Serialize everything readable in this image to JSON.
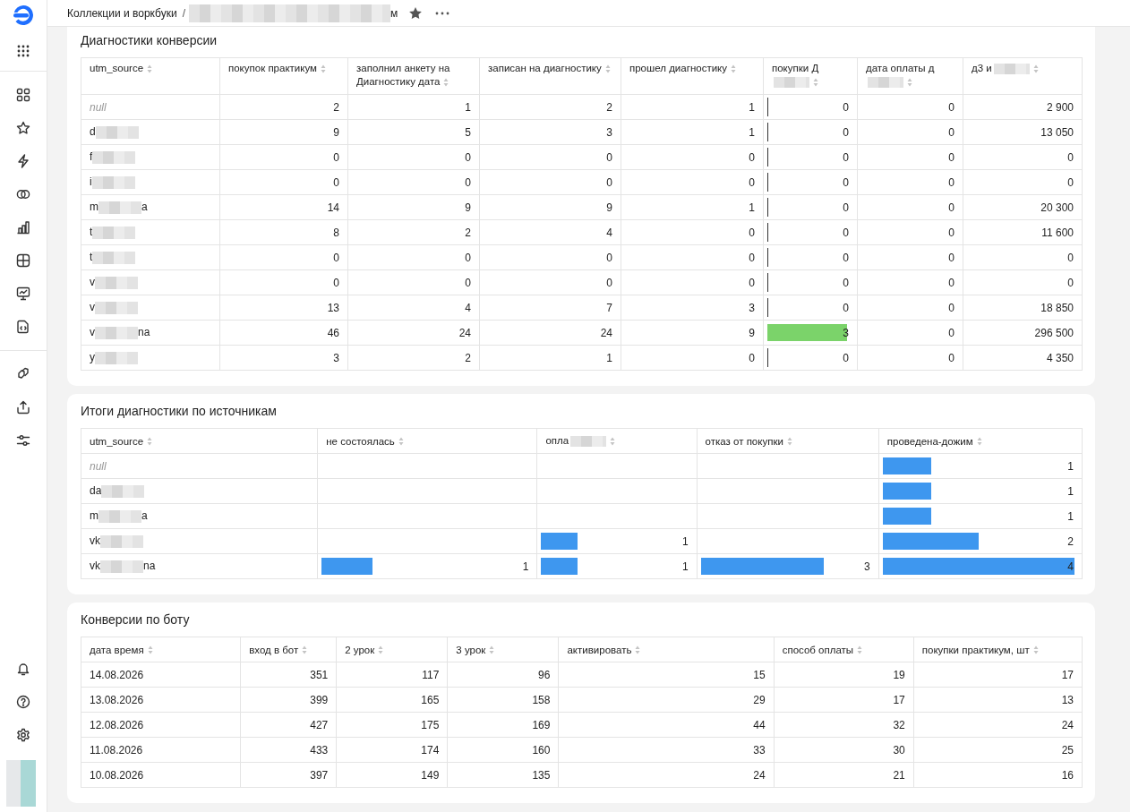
{
  "breadcrumb": {
    "root": "Коллекции и воркбуки",
    "separator": "/",
    "current_end": "м",
    "redacted": true
  },
  "tables": [
    {
      "title": "Диагностики конверсии",
      "columns": [
        {
          "label": "utm_source",
          "kind": "source",
          "redacted": false
        },
        {
          "label": "покупок практикум",
          "kind": "number",
          "redacted": false
        },
        {
          "label": "заполнил анкету на Диагностику дата",
          "kind": "number",
          "redacted": false
        },
        {
          "label": "записан на диагностику",
          "kind": "number",
          "redacted": false
        },
        {
          "label": "прошел диагностику",
          "kind": "number",
          "redacted": false
        },
        {
          "label": "покупки Д",
          "kind": "bar",
          "redacted": true
        },
        {
          "label": "дата оплаты д",
          "kind": "number",
          "redacted": true
        },
        {
          "label": "д3 и",
          "kind": "number",
          "redacted": true
        }
      ],
      "rows": [
        {
          "cells": [
            {
              "start": "null",
              "is_null": true,
              "redacted": false
            },
            "2",
            "1",
            "2",
            "1",
            {
              "value": "0",
              "level": 0
            },
            "0",
            "2 900"
          ]
        },
        {
          "cells": [
            {
              "start": "d",
              "is_null": false,
              "redacted": true
            },
            "9",
            "5",
            "3",
            "1",
            {
              "value": "0",
              "level": 0
            },
            "0",
            "13 050"
          ]
        },
        {
          "cells": [
            {
              "start": "f",
              "is_null": false,
              "redacted": true
            },
            "0",
            "0",
            "0",
            "0",
            {
              "value": "0",
              "level": 0
            },
            "0",
            "0"
          ]
        },
        {
          "cells": [
            {
              "start": "i",
              "is_null": false,
              "redacted": true
            },
            "0",
            "0",
            "0",
            "0",
            {
              "value": "0",
              "level": 0
            },
            "0",
            "0"
          ]
        },
        {
          "cells": [
            {
              "start": "m",
              "end": "a",
              "is_null": false,
              "redacted": true
            },
            "14",
            "9",
            "9",
            "1",
            {
              "value": "0",
              "level": 0
            },
            "0",
            "20 300"
          ]
        },
        {
          "cells": [
            {
              "start": "t",
              "is_null": false,
              "redacted": true
            },
            "8",
            "2",
            "4",
            "0",
            {
              "value": "0",
              "level": 0
            },
            "0",
            "11 600"
          ]
        },
        {
          "cells": [
            {
              "start": "t",
              "is_null": false,
              "redacted": true
            },
            "0",
            "0",
            "0",
            "0",
            {
              "value": "0",
              "level": 0
            },
            "0",
            "0"
          ]
        },
        {
          "cells": [
            {
              "start": "v",
              "is_null": false,
              "redacted": true
            },
            "0",
            "0",
            "0",
            "0",
            {
              "value": "0",
              "level": 0
            },
            "0",
            "0"
          ]
        },
        {
          "cells": [
            {
              "start": "v",
              "is_null": false,
              "redacted": true
            },
            "13",
            "4",
            "7",
            "3",
            {
              "value": "0",
              "level": 0
            },
            "0",
            "18 850"
          ]
        },
        {
          "cells": [
            {
              "start": "v",
              "end": "na",
              "is_null": false,
              "redacted": true
            },
            "46",
            "24",
            "24",
            "9",
            {
              "value": "3",
              "level": 0.93
            },
            "0",
            "296 500"
          ]
        },
        {
          "cells": [
            {
              "start": "y",
              "is_null": false,
              "redacted": true
            },
            "3",
            "2",
            "1",
            "0",
            {
              "value": "0",
              "level": 0
            },
            "0",
            "4 350"
          ]
        }
      ]
    },
    {
      "title": "Итоги диагностики по источникам",
      "columns": [
        {
          "label": "utm_source",
          "kind": "source",
          "redacted": false
        },
        {
          "label": "не состоялась",
          "kind": "bar",
          "redacted": false
        },
        {
          "label": "опла",
          "kind": "bar",
          "redacted": true
        },
        {
          "label": "отказ от покупки",
          "kind": "bar",
          "redacted": false
        },
        {
          "label": "проведена-дожим",
          "kind": "bar",
          "redacted": false
        }
      ],
      "rows": [
        {
          "cells": [
            {
              "start": "null",
              "is_null": true,
              "redacted": false
            },
            null,
            null,
            null,
            {
              "value": "1",
              "level": 0.25
            }
          ]
        },
        {
          "cells": [
            {
              "start": "da",
              "is_null": false,
              "redacted": true
            },
            null,
            null,
            null,
            {
              "value": "1",
              "level": 0.25
            }
          ]
        },
        {
          "cells": [
            {
              "start": "m",
              "end": "a",
              "is_null": false,
              "redacted": true
            },
            null,
            null,
            null,
            {
              "value": "1",
              "level": 0.25
            }
          ]
        },
        {
          "cells": [
            {
              "start": "vk",
              "is_null": false,
              "redacted": true
            },
            null,
            {
              "value": "1",
              "level": 0.24
            },
            null,
            {
              "value": "2",
              "level": 0.49
            }
          ]
        },
        {
          "cells": [
            {
              "start": "vk",
              "end": "na",
              "is_null": false,
              "redacted": true
            },
            {
              "value": "1",
              "level": 0.24
            },
            {
              "value": "1",
              "level": 0.24
            },
            {
              "value": "3",
              "level": 0.71
            },
            {
              "value": "4",
              "level": 0.98
            }
          ]
        }
      ]
    },
    {
      "title": "Конверсии по боту",
      "columns": [
        {
          "label": "дата время",
          "kind": "text",
          "redacted": false
        },
        {
          "label": "вход в бот",
          "kind": "number",
          "redacted": false
        },
        {
          "label": "2 урок",
          "kind": "number",
          "redacted": false
        },
        {
          "label": "3 урок",
          "kind": "number",
          "redacted": false
        },
        {
          "label": "активировать",
          "kind": "number",
          "redacted": false
        },
        {
          "label": "способ оплаты",
          "kind": "number",
          "redacted": false
        },
        {
          "label": "покупки практикум, шт",
          "kind": "number",
          "redacted": false
        }
      ],
      "rows": [
        {
          "cells": [
            "14.08.2026",
            "351",
            "117",
            "96",
            "15",
            "19",
            "17"
          ]
        },
        {
          "cells": [
            "13.08.2026",
            "399",
            "165",
            "158",
            "29",
            "17",
            "13"
          ]
        },
        {
          "cells": [
            "12.08.2026",
            "427",
            "175",
            "169",
            "44",
            "32",
            "24"
          ]
        },
        {
          "cells": [
            "11.08.2026",
            "433",
            "174",
            "160",
            "33",
            "30",
            "25"
          ]
        },
        {
          "cells": [
            "10.08.2026",
            "397",
            "149",
            "135",
            "24",
            "21",
            "16"
          ]
        }
      ]
    }
  ]
}
